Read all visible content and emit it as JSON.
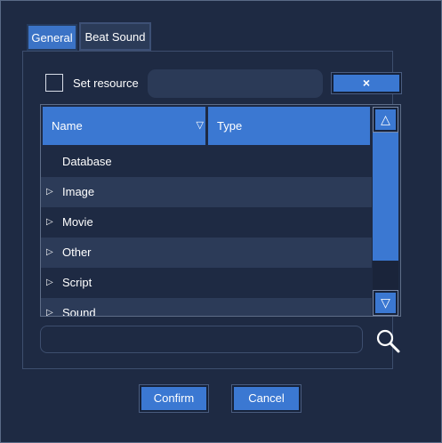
{
  "tabs": [
    {
      "label": "General",
      "active": true
    },
    {
      "label": "Beat Sound",
      "active": false
    }
  ],
  "resource": {
    "checkbox_label": "Set resource",
    "checked": false,
    "value": "",
    "clear_label": "×"
  },
  "table": {
    "columns": [
      "Name",
      "Type"
    ],
    "rows": [
      {
        "name": "Database",
        "type": "",
        "expandable": false
      },
      {
        "name": "Image",
        "type": "",
        "expandable": true
      },
      {
        "name": "Movie",
        "type": "",
        "expandable": true
      },
      {
        "name": "Other",
        "type": "",
        "expandable": true
      },
      {
        "name": "Script",
        "type": "",
        "expandable": true
      },
      {
        "name": "Sound",
        "type": "",
        "expandable": true
      }
    ]
  },
  "icons": {
    "sort": "▽",
    "expand": "▷",
    "scroll_up": "△",
    "scroll_down": "▽"
  },
  "search": {
    "value": ""
  },
  "buttons": {
    "confirm": "Confirm",
    "cancel": "Cancel"
  },
  "colors": {
    "accent": "#3b78d2",
    "background": "#1e2a43",
    "row_alt": "#2c3b58"
  }
}
